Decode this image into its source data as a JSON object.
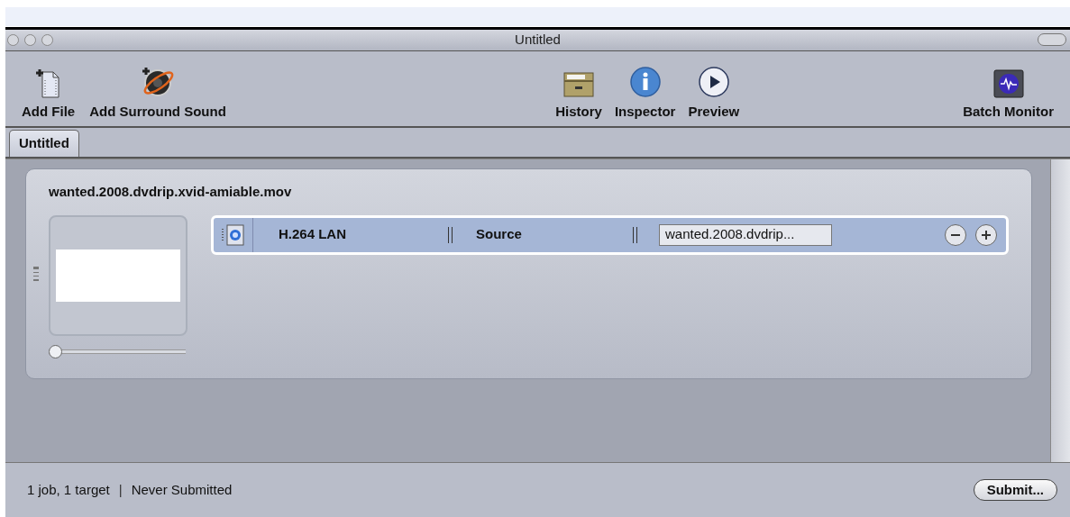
{
  "window": {
    "title": "Untitled"
  },
  "toolbar": {
    "left": [
      {
        "label": "Add File"
      },
      {
        "label": "Add Surround Sound"
      }
    ],
    "right": [
      {
        "label": "History"
      },
      {
        "label": "Inspector"
      },
      {
        "label": "Preview"
      },
      {
        "label": "Batch Monitor"
      }
    ]
  },
  "tabs": [
    {
      "label": "Untitled",
      "selected": true
    }
  ],
  "job": {
    "title": "wanted.2008.dvdrip.xvid-amiable.mov",
    "slider": {
      "level": 0
    },
    "targets": [
      {
        "setting": "H.264 LAN",
        "destination": "Source",
        "output": "wanted.2008.dvdrip...",
        "selected": true
      }
    ]
  },
  "status_bar": {
    "summary": "1 job, 1 target",
    "separator": "|",
    "state": "Never Submitted",
    "button": "Submit..."
  }
}
